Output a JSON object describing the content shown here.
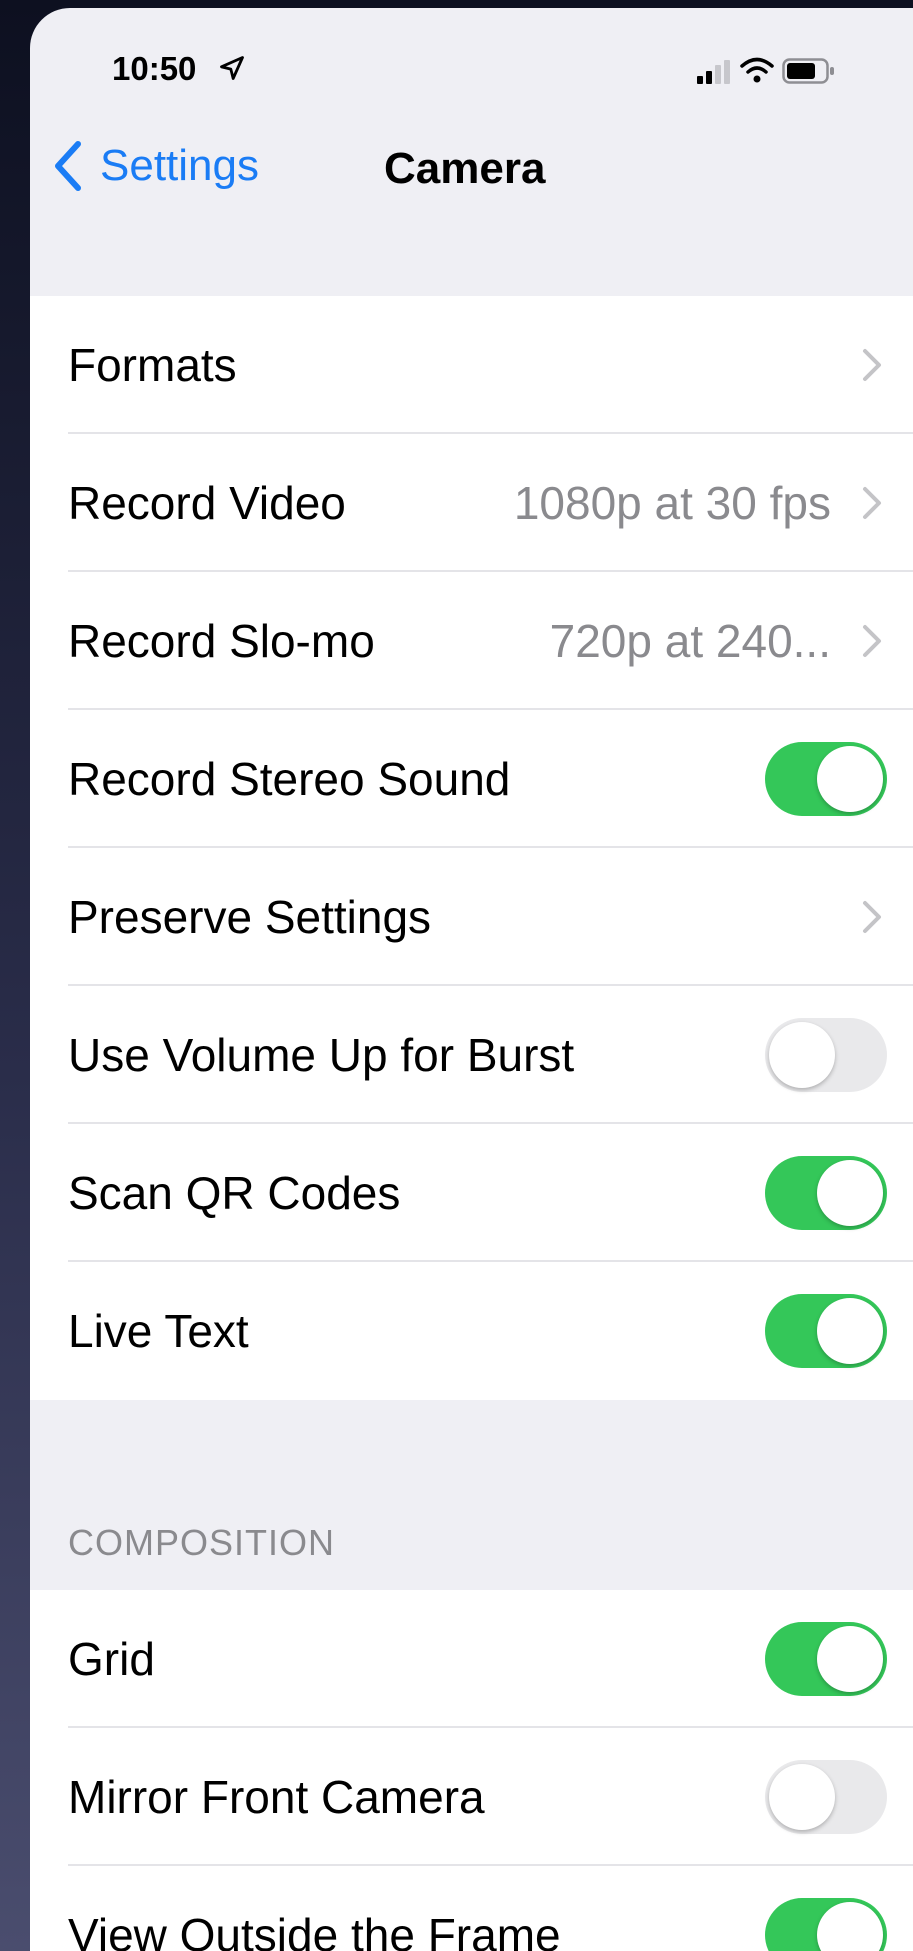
{
  "status": {
    "time": "10:50"
  },
  "nav": {
    "back_label": "Settings",
    "title": "Camera"
  },
  "group1": [
    {
      "label": "Formats",
      "type": "chevron"
    },
    {
      "label": "Record Video",
      "value": "1080p at 30 fps",
      "type": "chevron"
    },
    {
      "label": "Record Slo-mo",
      "value": "720p at 240...",
      "type": "chevron"
    },
    {
      "label": "Record Stereo Sound",
      "type": "toggle",
      "on": true
    },
    {
      "label": "Preserve Settings",
      "type": "chevron"
    },
    {
      "label": "Use Volume Up for Burst",
      "type": "toggle",
      "on": false
    },
    {
      "label": "Scan QR Codes",
      "type": "toggle",
      "on": true
    },
    {
      "label": "Live Text",
      "type": "toggle",
      "on": true
    }
  ],
  "section": {
    "header": "COMPOSITION"
  },
  "group2": [
    {
      "label": "Grid",
      "type": "toggle",
      "on": true
    },
    {
      "label": "Mirror Front Camera",
      "type": "toggle",
      "on": false
    },
    {
      "label": "View Outside the Frame",
      "type": "toggle",
      "on": true
    }
  ],
  "colors": {
    "accent": "#1a7cf5",
    "toggle_on": "#34c759",
    "toggle_off": "#e9e9eb"
  },
  "icons": [
    "location-arrow-icon",
    "signal-icon",
    "wifi-icon",
    "battery-icon",
    "back-chevron-icon",
    "chevron-right-icon"
  ]
}
